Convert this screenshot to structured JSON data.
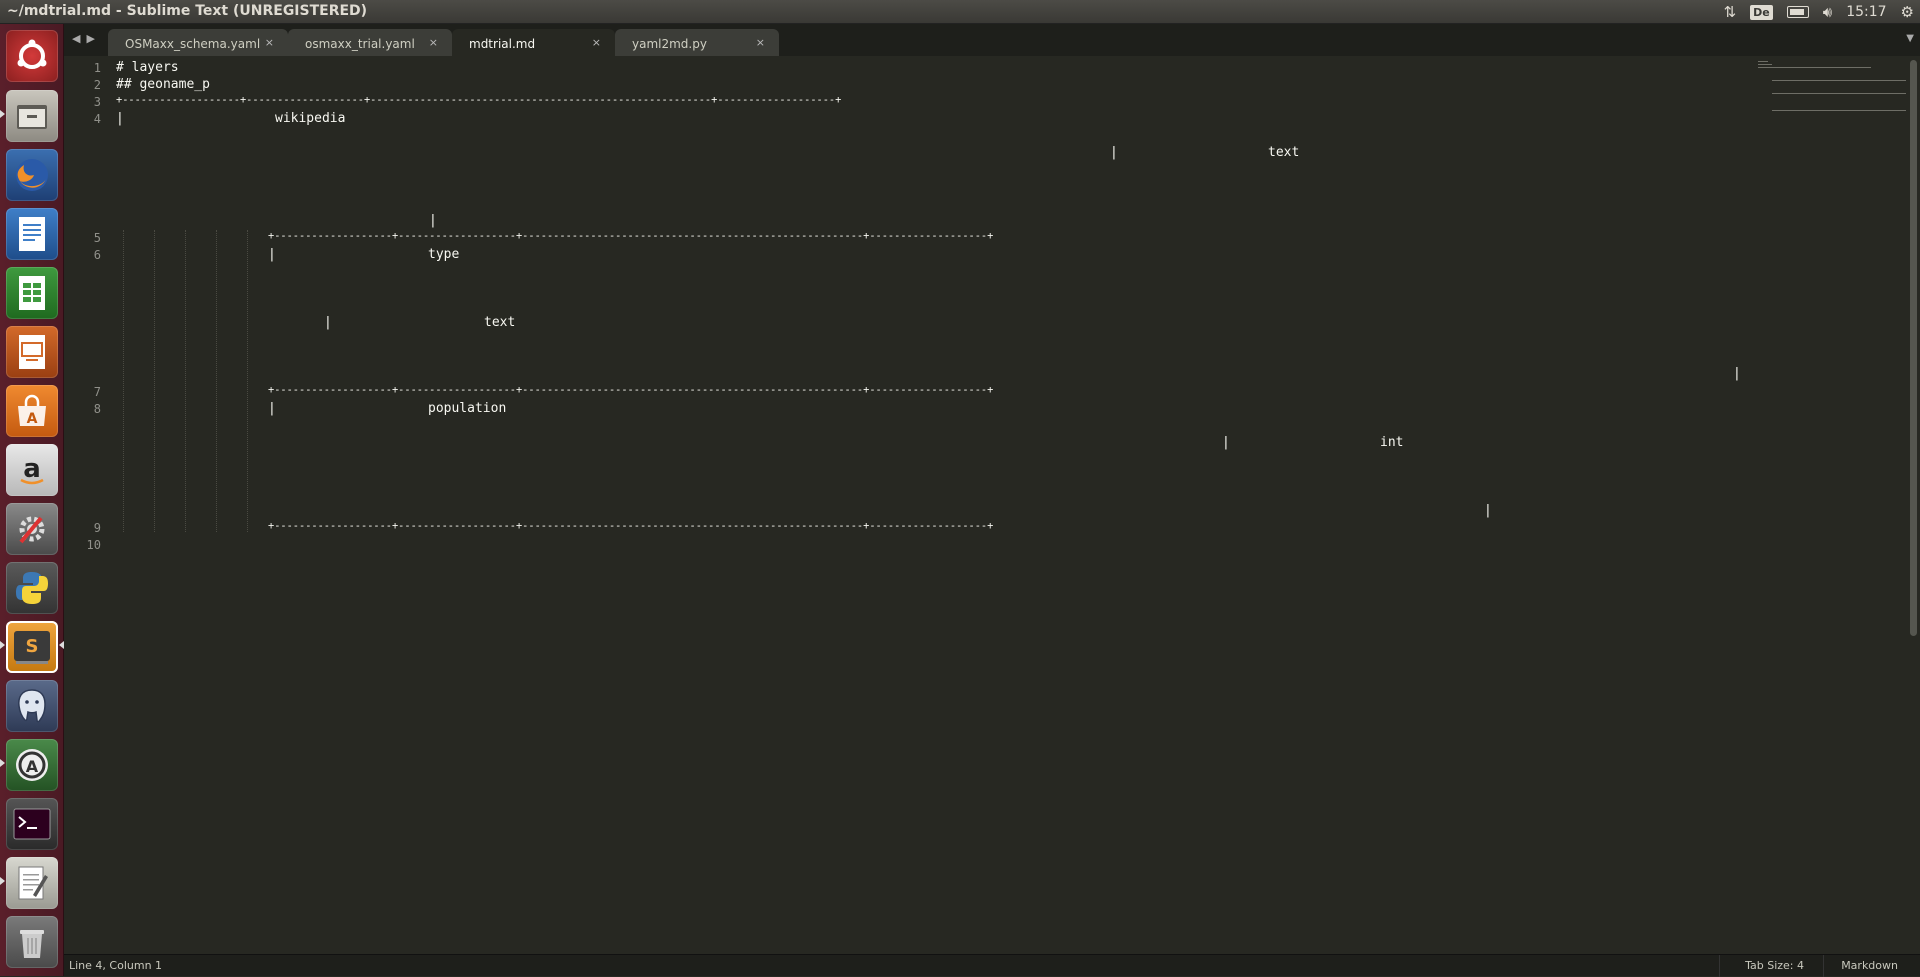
{
  "window": {
    "title": "~/mdtrial.md - Sublime Text (UNREGISTERED)"
  },
  "tray": {
    "keyboard": "De",
    "clock": "15:17"
  },
  "launcher": {
    "items": [
      {
        "name": "ubuntu-dash-icon"
      },
      {
        "name": "files-icon"
      },
      {
        "name": "firefox-icon"
      },
      {
        "name": "libreoffice-writer-icon"
      },
      {
        "name": "libreoffice-calc-icon"
      },
      {
        "name": "libreoffice-impress-icon"
      },
      {
        "name": "software-center-icon"
      },
      {
        "name": "amazon-icon"
      },
      {
        "name": "system-settings-icon"
      },
      {
        "name": "python-icon"
      },
      {
        "name": "sublime-text-icon"
      },
      {
        "name": "postgresql-icon"
      },
      {
        "name": "software-updater-icon"
      },
      {
        "name": "terminal-icon"
      },
      {
        "name": "text-editor-icon"
      },
      {
        "name": "trash-icon"
      }
    ]
  },
  "tabs": [
    {
      "label": "OSMaxx_schema.yaml",
      "active": false
    },
    {
      "label": "osmaxx_trial.yaml",
      "active": false
    },
    {
      "label": "mdtrial.md",
      "active": true
    },
    {
      "label": "yaml2md.py",
      "active": false
    }
  ],
  "tab_close_glyph": "×",
  "line_numbers": [
    "1",
    "2",
    "3",
    "4",
    "5",
    "6",
    "7",
    "8",
    "9",
    "10"
  ],
  "code": {
    "l1": "# layers",
    "l2": "## geoname_p",
    "l3": "+-------------------+-------------------+-------------------------------------------------------+-------------------+",
    "l4_bar": "|",
    "l4_word": "wikipedia",
    "l4b_bar": "|",
    "l4b_word": "text",
    "l4c_bar": "|",
    "l5": "+-------------------+-------------------+-------------------------------------------------------+-------------------+",
    "l6_bar": "|",
    "l6_word": "type",
    "l6b_bar": "|",
    "l6b_word": "text",
    "l6c_bar": "|",
    "l7": "+-------------------+-------------------+-------------------------------------------------------+-------------------+",
    "l8_bar": "|",
    "l8_word": "population",
    "l8b_bar": "|",
    "l8b_word": "int",
    "l8c_bar": "|",
    "l9": "+-------------------+-------------------+-------------------------------------------------------+-------------------+"
  },
  "status": {
    "position": "Line 4, Column 1",
    "tab_size": "Tab Size: 4",
    "syntax": "Markdown"
  },
  "colors": {
    "editor_bg": "#272822",
    "launcher_bg": "#5a1f2a",
    "text": "#f8f8f2"
  }
}
